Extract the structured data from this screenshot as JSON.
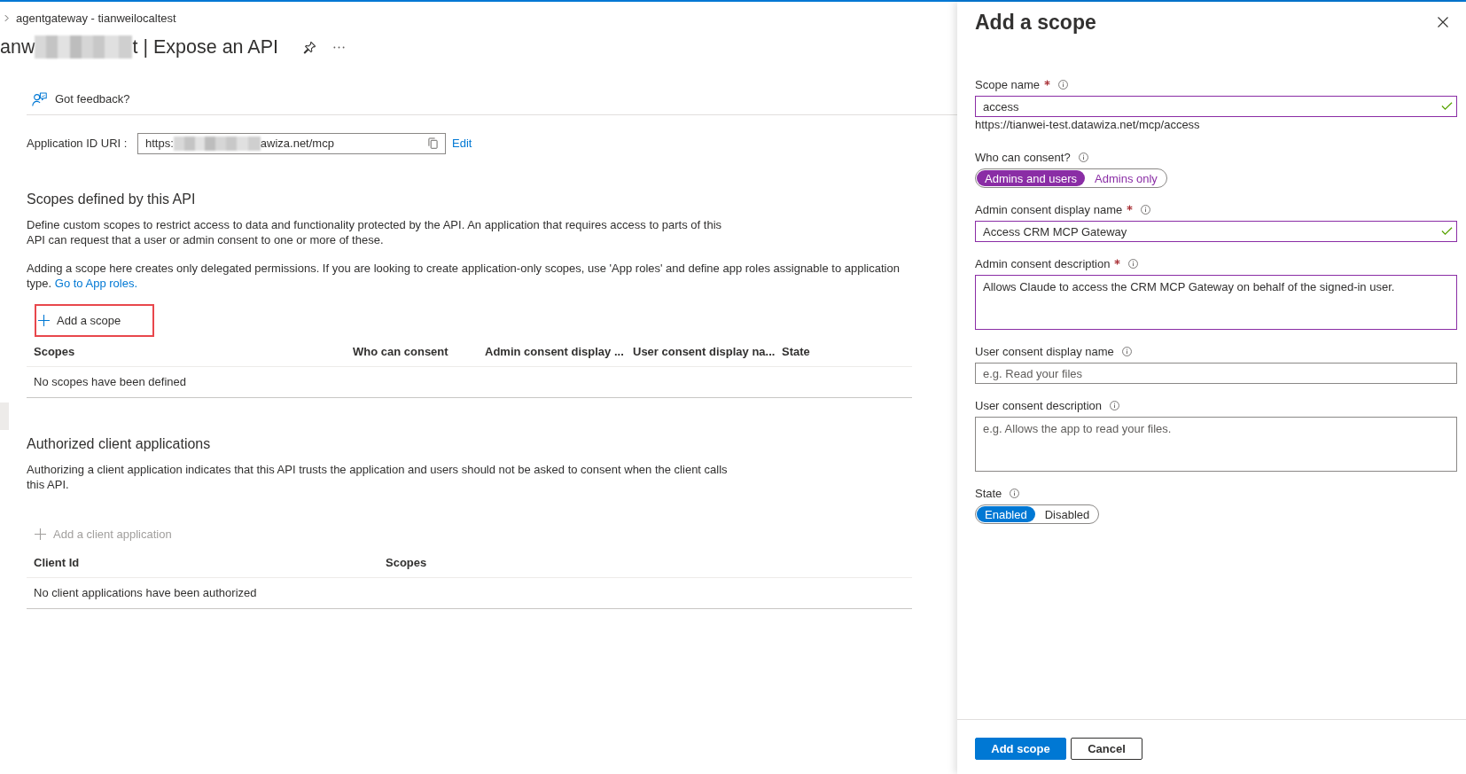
{
  "breadcrumb": "agentgateway - tianweilocaltest",
  "page_title": {
    "visible_start": "anw",
    "visible_end": "t | Expose an API"
  },
  "feedback_button": "Got feedback?",
  "application_id_uri": {
    "label": "Application ID URI :",
    "value_start": "https:",
    "value_end": "awiza.net/mcp",
    "edit_link": "Edit"
  },
  "scopes_section": {
    "heading": "Scopes defined by this API",
    "description": "Define custom scopes to restrict access to data and functionality protected by the API. An application that requires access to parts of this API can request that a user or admin consent to one or more of these.",
    "note": "Adding a scope here creates only delegated permissions. If you are looking to create application-only scopes, use 'App roles' and define app roles assignable to application type.",
    "note_link": "Go to App roles.",
    "add_button": {
      "label": "Add a scope",
      "highlighted": true,
      "disabled": false
    },
    "table": {
      "columns": [
        "Scopes",
        "Who can consent",
        "Admin consent display ...",
        "User consent display na...",
        "State"
      ],
      "empty_message": "No scopes have been defined"
    }
  },
  "clients_section": {
    "heading": "Authorized client applications",
    "description": "Authorizing a client application indicates that this API trusts the application and users should not be asked to consent when the client calls this API.",
    "add_button": {
      "label": "Add a client application",
      "highlighted": false,
      "disabled": true
    },
    "table": {
      "columns": [
        "Client Id",
        "Scopes"
      ],
      "empty_message": "No client applications have been authorized"
    }
  },
  "panel": {
    "title": "Add a scope",
    "fields": [
      {
        "kind": "input",
        "label": "Scope name",
        "required": true,
        "value": "access",
        "modified": true,
        "valid": true,
        "hint": "https://tianwei-test.datawiza.net/mcp/access"
      },
      {
        "kind": "toggle",
        "label": "Who can consent?",
        "required": false,
        "modified": true,
        "options": [
          {
            "label": "Admins and users",
            "selected": true
          },
          {
            "label": "Admins only",
            "selected": false
          }
        ]
      },
      {
        "kind": "input",
        "label": "Admin consent display name",
        "required": true,
        "value": "Access CRM MCP Gateway",
        "modified": true,
        "valid": true
      },
      {
        "kind": "textarea",
        "label": "Admin consent description",
        "required": true,
        "value": "Allows Claude to access the CRM MCP Gateway on behalf of the signed-in user.",
        "modified": true,
        "valid": false
      },
      {
        "kind": "input",
        "label": "User consent display name",
        "required": false,
        "placeholder": "e.g. Read your files",
        "modified": false,
        "valid": false
      },
      {
        "kind": "textarea",
        "label": "User consent description",
        "required": false,
        "placeholder": "e.g. Allows the app to read your files.",
        "modified": false,
        "valid": false
      },
      {
        "kind": "toggle",
        "label": "State",
        "required": false,
        "modified": false,
        "options": [
          {
            "label": "Enabled",
            "selected": true
          },
          {
            "label": "Disabled",
            "selected": false
          }
        ]
      }
    ],
    "buttons": [
      {
        "label": "Add scope",
        "kind": "primary"
      },
      {
        "label": "Cancel",
        "kind": "secondary"
      }
    ]
  }
}
